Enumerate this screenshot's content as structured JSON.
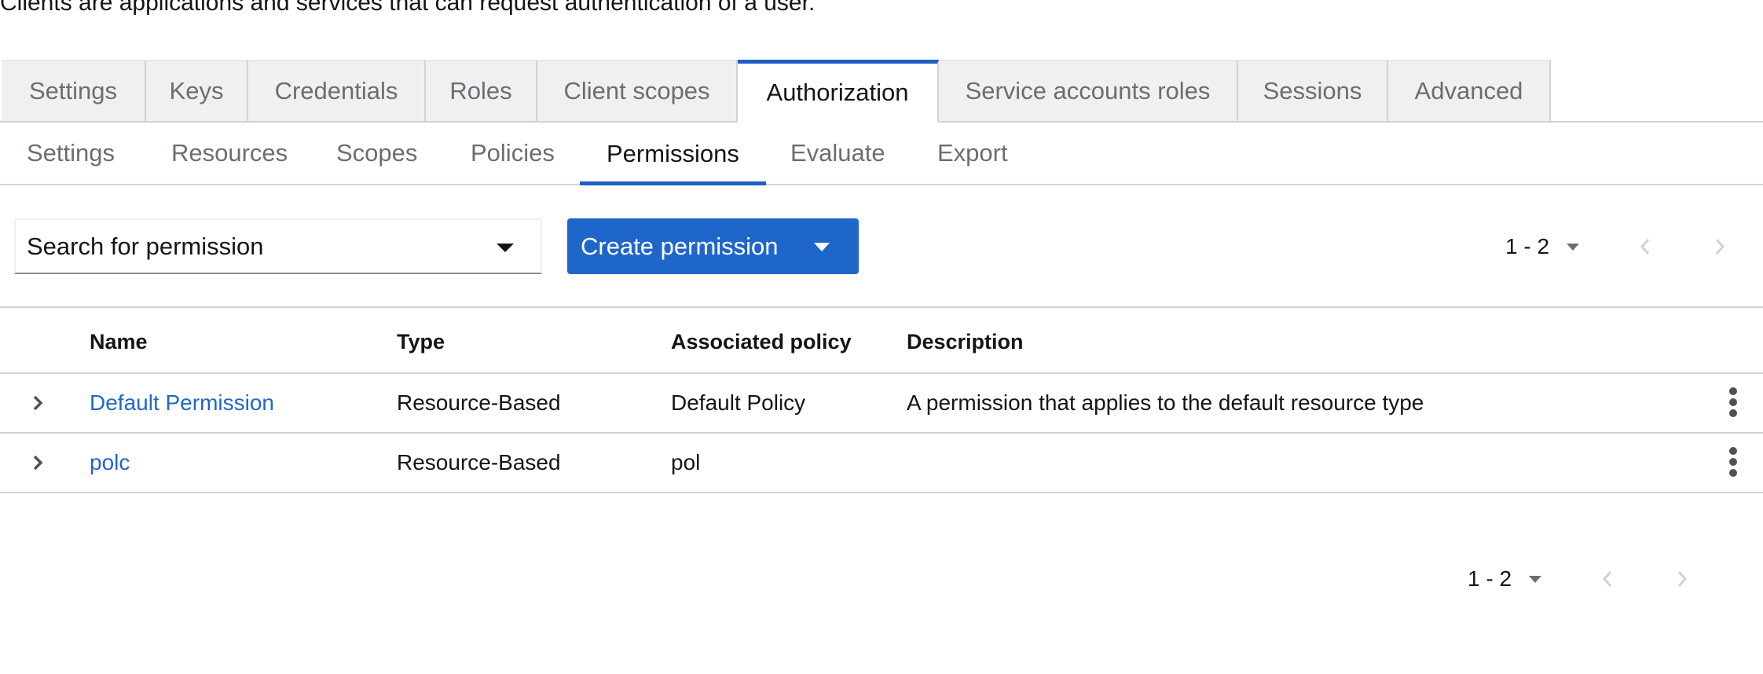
{
  "intro_text": "Clients are applications and services that can request authentication of a user.",
  "tabs": [
    {
      "label": "Settings"
    },
    {
      "label": "Keys"
    },
    {
      "label": "Credentials"
    },
    {
      "label": "Roles"
    },
    {
      "label": "Client scopes"
    },
    {
      "label": "Authorization"
    },
    {
      "label": "Service accounts roles"
    },
    {
      "label": "Sessions"
    },
    {
      "label": "Advanced"
    }
  ],
  "subtabs": [
    {
      "label": "Settings"
    },
    {
      "label": "Resources"
    },
    {
      "label": "Scopes"
    },
    {
      "label": "Policies"
    },
    {
      "label": "Permissions"
    },
    {
      "label": "Evaluate"
    },
    {
      "label": "Export"
    }
  ],
  "toolbar": {
    "search_label": "Search for permission",
    "create_label": "Create permission",
    "pagination": "1 - 2"
  },
  "table": {
    "headers": {
      "name": "Name",
      "type": "Type",
      "policy": "Associated policy",
      "description": "Description"
    },
    "rows": [
      {
        "name": "Default Permission",
        "type": "Resource-Based",
        "policy": "Default Policy",
        "description": "A permission that applies to the default resource type"
      },
      {
        "name": "polc",
        "type": "Resource-Based",
        "policy": "pol",
        "description": ""
      }
    ]
  },
  "footer": {
    "pagination": "1 - 2"
  },
  "colors": {
    "accent": "#1f66cb",
    "active_tab_border": "#1f5fc2",
    "inactive_tab_bg": "#f0f0f0"
  }
}
